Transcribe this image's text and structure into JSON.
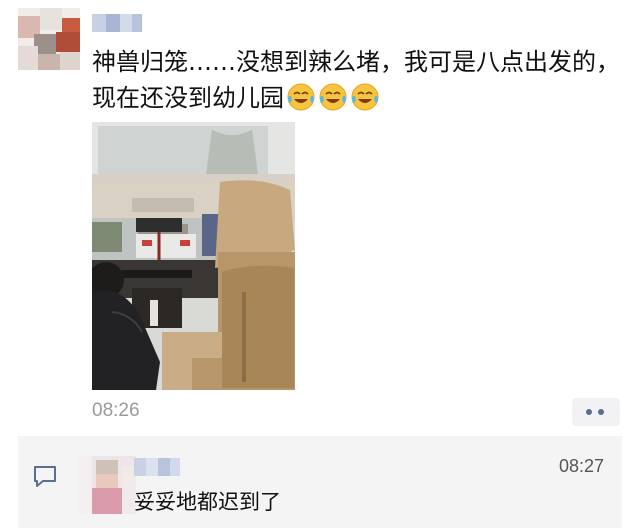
{
  "post": {
    "text": "神兽归笼……没想到辣么堵，我可是八点出发的，现在还没到幼儿园",
    "emojis": [
      "laughing-crying-emoji",
      "laughing-crying-emoji",
      "laughing-crying-emoji"
    ],
    "time": "08:26"
  },
  "comment": {
    "text": "妥妥地都迟到了",
    "time": "08:27"
  },
  "colors": {
    "link_blue": "#5a6d92",
    "muted": "#9a9a9a",
    "comment_bg": "#f4f4f4"
  }
}
